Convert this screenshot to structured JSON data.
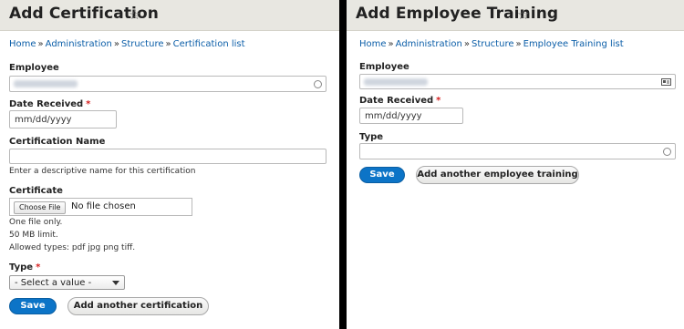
{
  "left": {
    "title": "Add Certification",
    "breadcrumb": [
      "Home",
      "Administration",
      "Structure",
      "Certification list"
    ],
    "employee": {
      "label": "Employee"
    },
    "date_received": {
      "label": "Date Received",
      "placeholder": "mm/dd/yyyy"
    },
    "certification_name": {
      "label": "Certification Name",
      "description": "Enter a descriptive name for this certification"
    },
    "certificate": {
      "label": "Certificate",
      "choose_label": "Choose File",
      "status": "No file chosen",
      "help": [
        "One file only.",
        "50 MB limit.",
        "Allowed types: pdf jpg png tiff."
      ]
    },
    "type": {
      "label": "Type",
      "selected": "- Select a value -"
    },
    "save_label": "Save",
    "add_another_label": "Add another certification"
  },
  "right": {
    "title": "Add Employee Training",
    "breadcrumb": [
      "Home",
      "Administration",
      "Structure",
      "Employee Training list"
    ],
    "employee": {
      "label": "Employee"
    },
    "date_received": {
      "label": "Date Received",
      "placeholder": "mm/dd/yyyy"
    },
    "type": {
      "label": "Type"
    },
    "save_label": "Save",
    "add_another_label": "Add another employee training"
  },
  "breadcrumb_separator": "»",
  "required_marker": "*",
  "favorite_star": "☆",
  "colors": {
    "link": "#0b5ea8",
    "primary_button": "#0c74c7",
    "required": "#d62020",
    "header_bg": "#e8e7e1"
  }
}
